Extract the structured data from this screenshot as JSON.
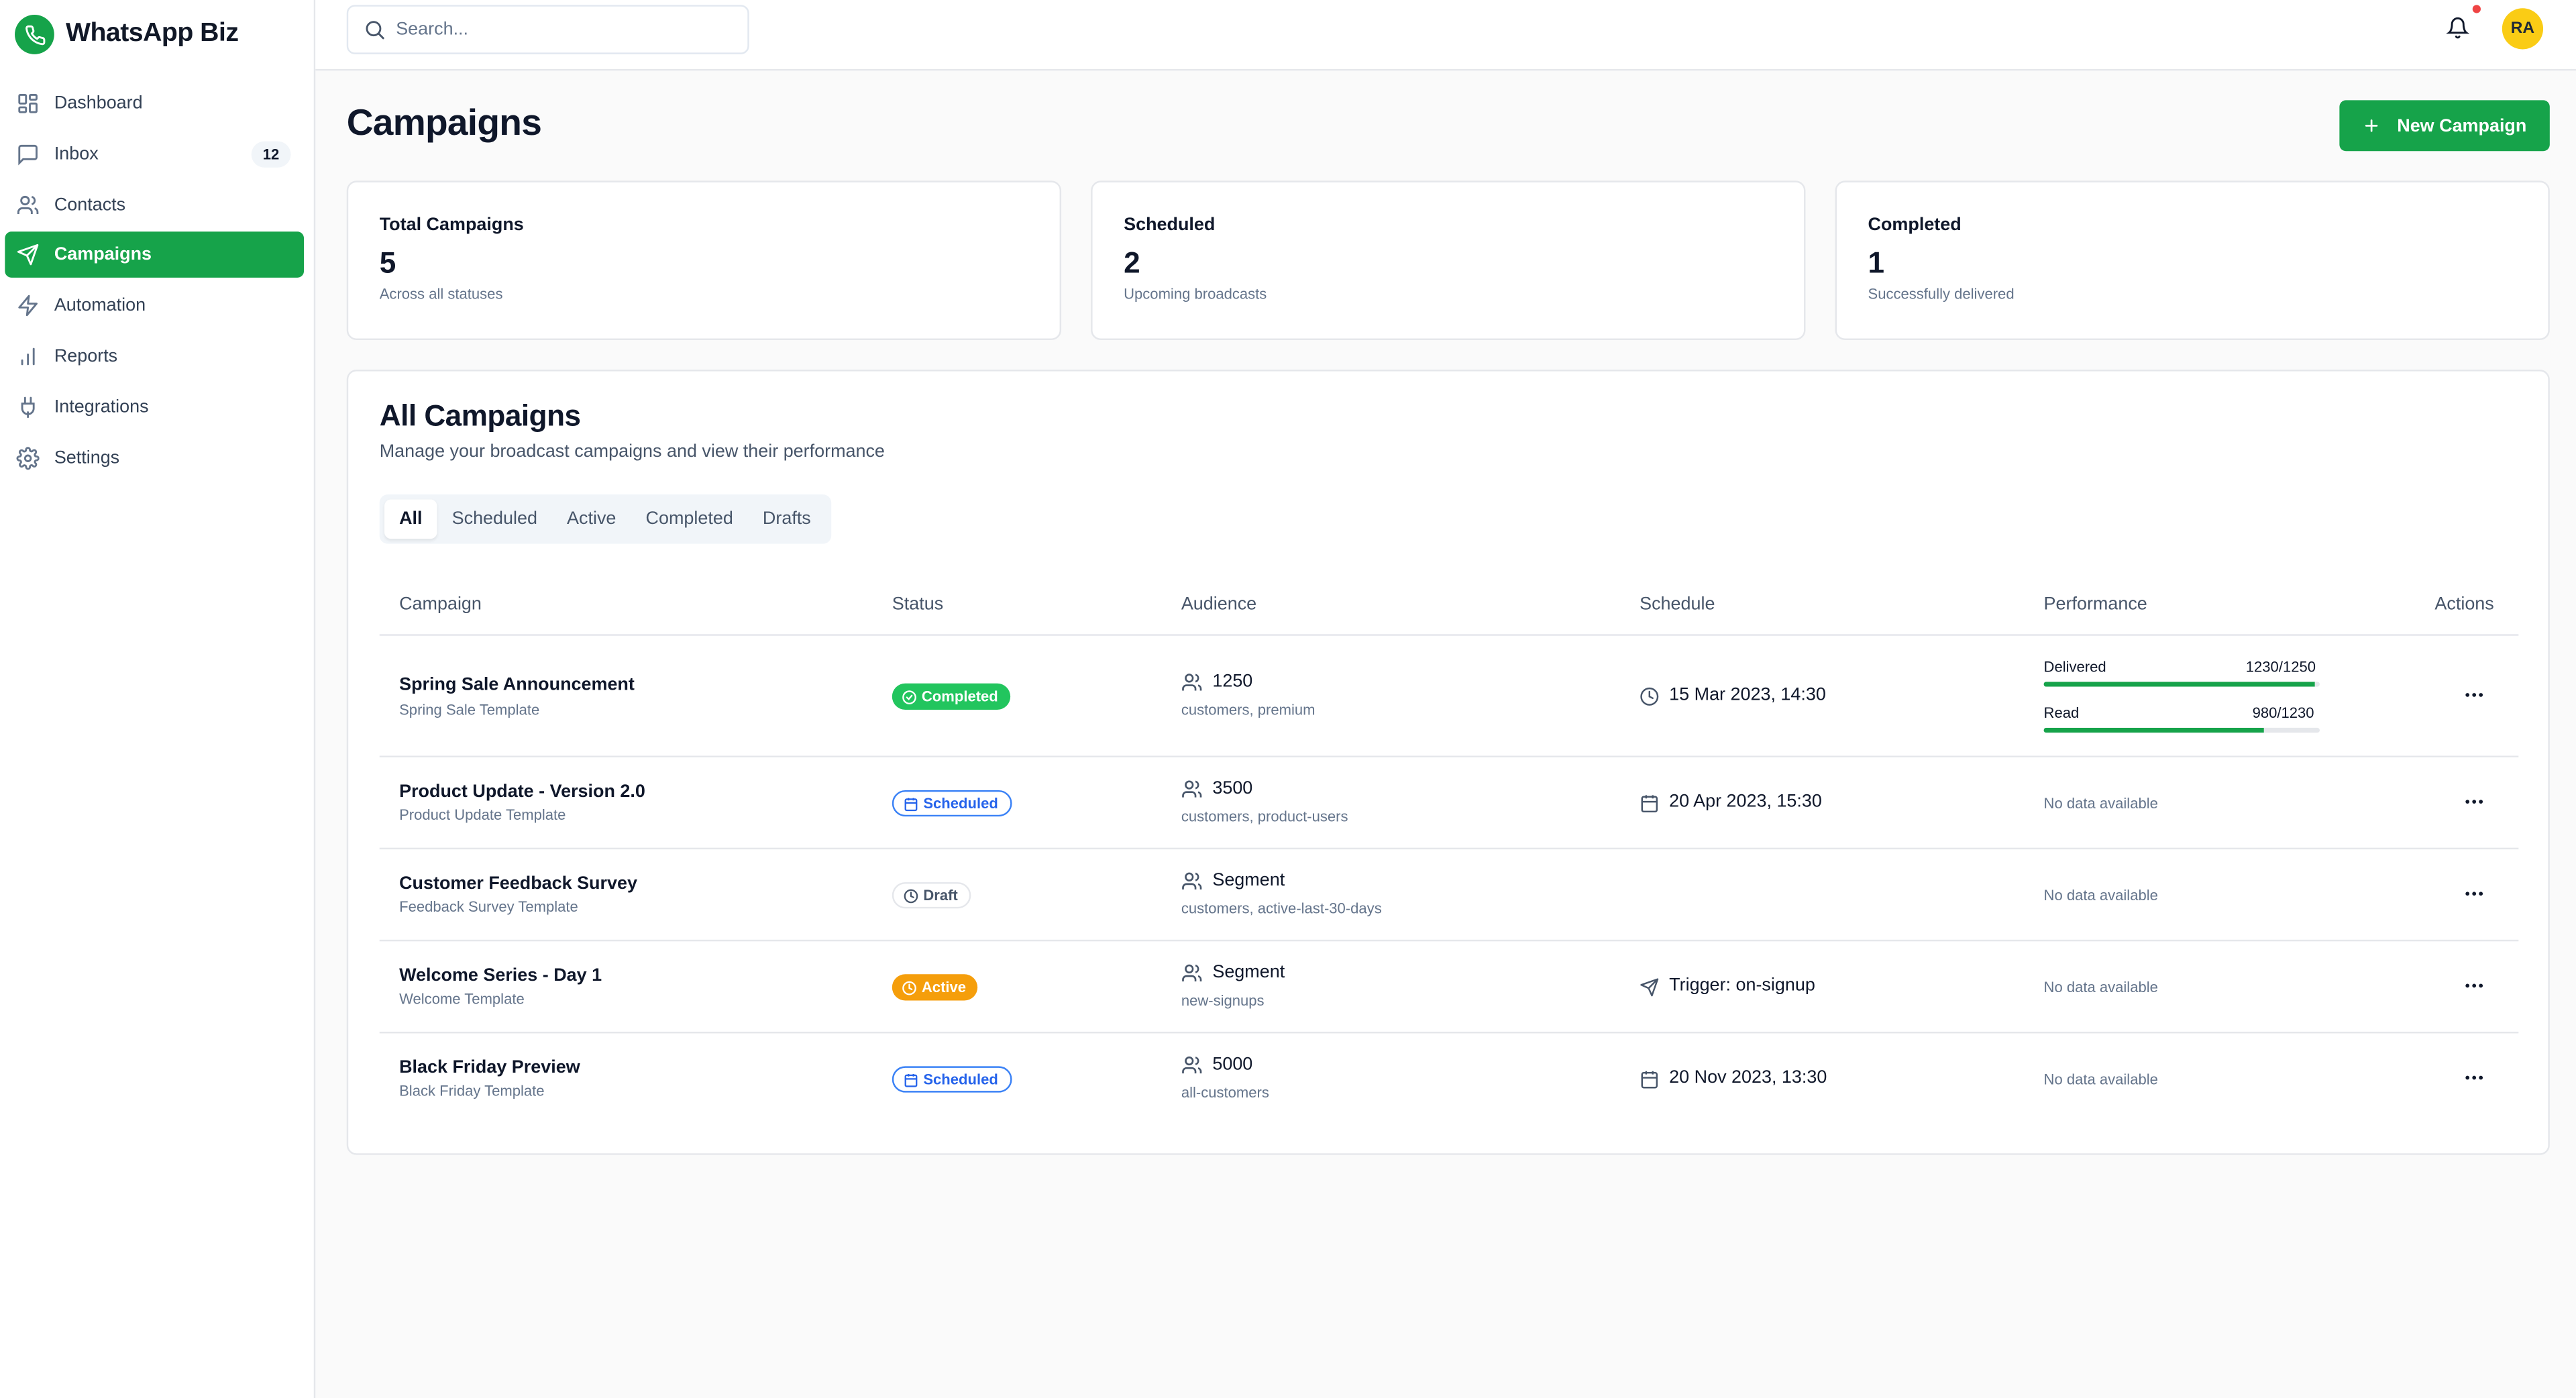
{
  "app": {
    "name": "WhatsApp Biz"
  },
  "sidebar": {
    "items": [
      {
        "label": "Dashboard",
        "icon": "dashboard-icon"
      },
      {
        "label": "Inbox",
        "icon": "message-icon",
        "badge": "12"
      },
      {
        "label": "Contacts",
        "icon": "users-icon"
      },
      {
        "label": "Campaigns",
        "icon": "send-icon",
        "active": true
      },
      {
        "label": "Automation",
        "icon": "lightning-icon"
      },
      {
        "label": "Reports",
        "icon": "bar-chart-icon"
      },
      {
        "label": "Integrations",
        "icon": "plug-icon"
      },
      {
        "label": "Settings",
        "icon": "gear-icon"
      }
    ]
  },
  "header": {
    "search_placeholder": "Search...",
    "avatar_initials": "RA"
  },
  "page": {
    "title": "Campaigns",
    "new_button": "New Campaign"
  },
  "stats": [
    {
      "label": "Total Campaigns",
      "value": "5",
      "sub": "Across all statuses"
    },
    {
      "label": "Scheduled",
      "value": "2",
      "sub": "Upcoming broadcasts"
    },
    {
      "label": "Completed",
      "value": "1",
      "sub": "Successfully delivered"
    }
  ],
  "panel": {
    "title": "All Campaigns",
    "subtitle": "Manage your broadcast campaigns and view their performance",
    "tabs": [
      "All",
      "Scheduled",
      "Active",
      "Completed",
      "Drafts"
    ],
    "active_tab": "All"
  },
  "table": {
    "columns": [
      "Campaign",
      "Status",
      "Audience",
      "Schedule",
      "Performance",
      "Actions"
    ],
    "rows": [
      {
        "name": "Spring Sale Announcement",
        "template": "Spring Sale Template",
        "status": "Completed",
        "audience": "1250",
        "audience_sub": "customers, premium",
        "schedule": "15 Mar 2023, 14:30",
        "schedule_icon": "clock-icon",
        "performance": {
          "delivered_label": "Delivered",
          "delivered_value": "1230/1250",
          "delivered_fraction": 0.984,
          "read_label": "Read",
          "read_value": "980/1230",
          "read_fraction": 0.797
        }
      },
      {
        "name": "Product Update - Version 2.0",
        "template": "Product Update Template",
        "status": "Scheduled",
        "audience": "3500",
        "audience_sub": "customers, product-users",
        "schedule": "20 Apr 2023, 15:30",
        "schedule_icon": "calendar-icon",
        "no_data": "No data available"
      },
      {
        "name": "Customer Feedback Survey",
        "template": "Feedback Survey Template",
        "status": "Draft",
        "audience": "Segment",
        "audience_sub": "customers, active-last-30-days",
        "schedule": "",
        "no_data": "No data available"
      },
      {
        "name": "Welcome Series - Day 1",
        "template": "Welcome Template",
        "status": "Active",
        "audience": "Segment",
        "audience_sub": "new-signups",
        "schedule": "Trigger: on-signup",
        "schedule_icon": "send-icon",
        "no_data": "No data available"
      },
      {
        "name": "Black Friday Preview",
        "template": "Black Friday Template",
        "status": "Scheduled",
        "audience": "5000",
        "audience_sub": "all-customers",
        "schedule": "20 Nov 2023, 13:30",
        "schedule_icon": "calendar-icon",
        "no_data": "No data available"
      }
    ]
  },
  "colors": {
    "brand": "#16a34a",
    "completed": "#22c55e",
    "scheduled": "#2563eb",
    "active": "#f59e0b",
    "avatar": "#facc15"
  }
}
